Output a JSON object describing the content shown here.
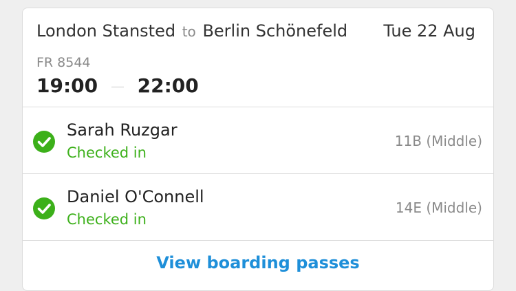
{
  "flight": {
    "origin": "London Stansted",
    "connector": "to",
    "destination": "Berlin Schönefeld",
    "date": "Tue 22 Aug",
    "flight_number": "FR 8544",
    "departure_time": "19:00",
    "arrival_time": "22:00"
  },
  "passengers": [
    {
      "name": "Sarah Ruzgar",
      "status": "Checked in",
      "seat": "11B (Middle)",
      "icon": "check-circle-icon"
    },
    {
      "name": "Daniel O'Connell",
      "status": "Checked in",
      "seat": "14E (Middle)",
      "icon": "check-circle-icon"
    }
  ],
  "actions": {
    "view_boarding_passes": "View boarding passes"
  },
  "colors": {
    "status_green": "#3cb01a",
    "link_blue": "#1e8fd9",
    "muted_gray": "#8a8a8a"
  }
}
